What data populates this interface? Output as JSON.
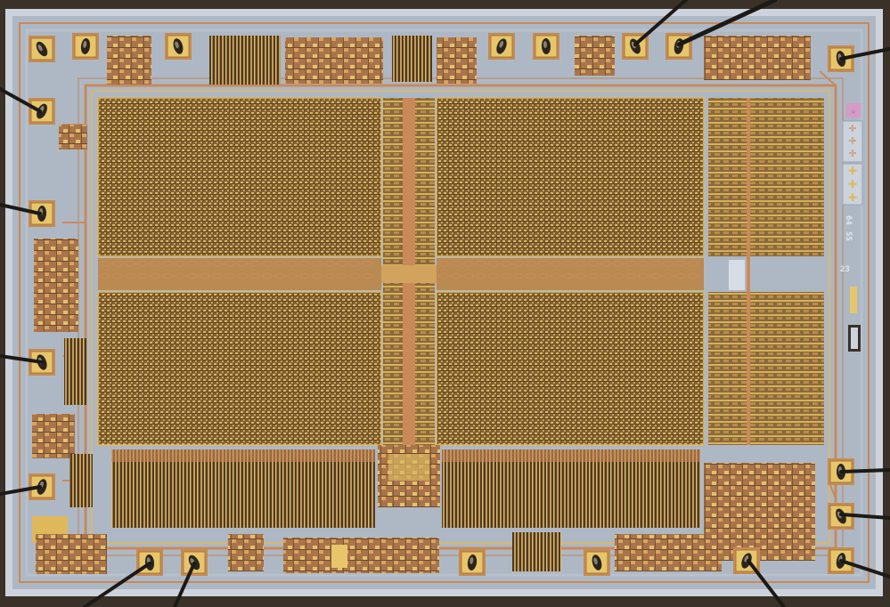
{
  "die_markings": {
    "number_a": "23",
    "number_b": "SS",
    "number_c": "64"
  },
  "colors": {
    "background": "#3a3128",
    "die_edge": "#cdd3dc",
    "substrate": "#aeb8c4",
    "metal_copper": "#c98a5a",
    "metal_gold": "#e0b85c",
    "memory_array": "#8f6e3c",
    "bond_pad": "#e7c66a",
    "bond_wire": "#1c1a17"
  }
}
